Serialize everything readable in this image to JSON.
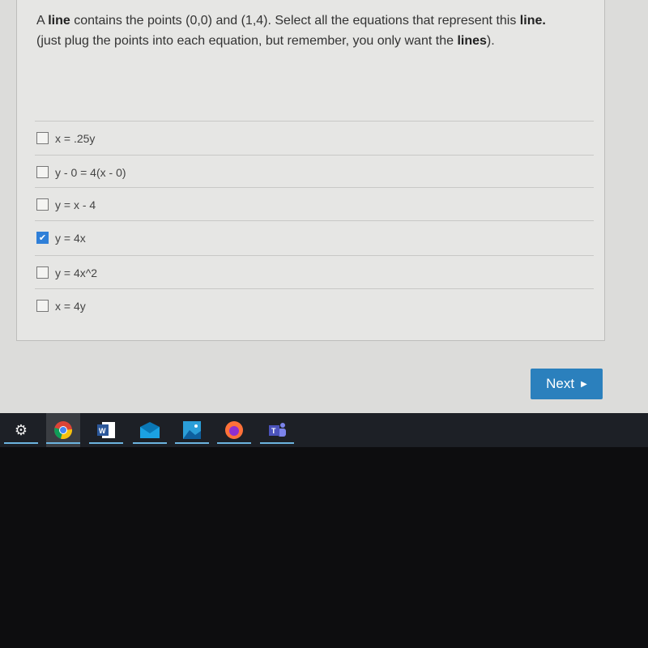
{
  "question": {
    "part1_prefix": "A ",
    "part1_bold": "line",
    "part1_mid": " contains the points (0,0) and (1,4). Select all the equations that represent this ",
    "part1_bold2": "line.",
    "part2_prefix": "(just plug the points into each equation, but remember, you only want the ",
    "part2_bold": "lines",
    "part2_suffix": ")."
  },
  "options": [
    {
      "label": "x = .25y",
      "checked": false
    },
    {
      "label": "y - 0 = 4(x - 0)",
      "checked": false
    },
    {
      "label": "y = x - 4",
      "checked": false
    },
    {
      "label": "y = 4x",
      "checked": true
    },
    {
      "label": "y = 4x^2",
      "checked": false
    },
    {
      "label": "x = 4y",
      "checked": false
    }
  ],
  "next_button": {
    "label": "Next",
    "icon": "caret-right-icon"
  },
  "taskbar": {
    "apps": [
      "settings-icon",
      "chrome-icon",
      "word-icon",
      "mail-icon",
      "photos-icon",
      "firefox-icon",
      "teams-icon"
    ]
  },
  "colors": {
    "accent": "#2b80bd",
    "checkbox": "#2f7fd8"
  }
}
